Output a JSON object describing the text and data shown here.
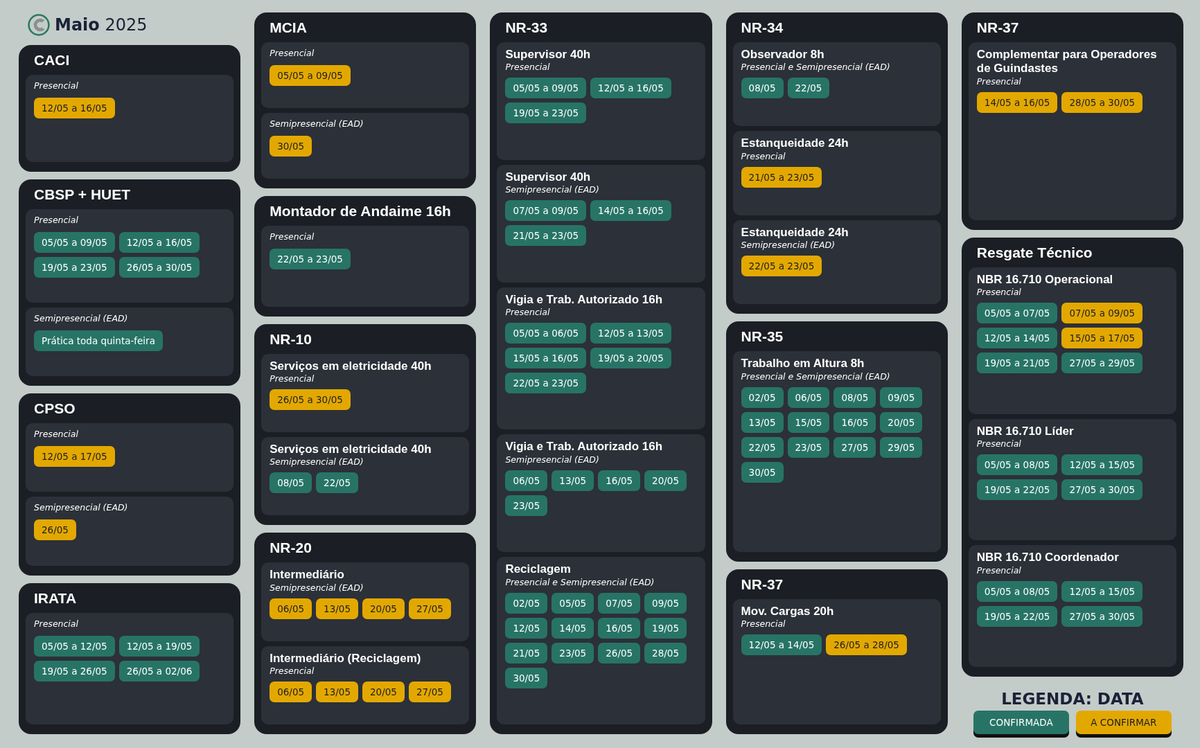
{
  "header": {
    "title": "**Maio** 2025"
  },
  "columns": [
    [
      {
        "title": "CACI",
        "sections": [
          {
            "mode": "Presencial",
            "dates": [
              {
                "text": "12/05 a 16/05",
                "confirmed": false
              }
            ]
          }
        ]
      },
      {
        "title": "CBSP + HUET",
        "sections": [
          {
            "mode": "Presencial",
            "dates": [
              {
                "text": "05/05 a 09/05",
                "confirmed": true
              },
              {
                "text": "12/05 a 16/05",
                "confirmed": true
              },
              {
                "text": "19/05 a 23/05",
                "confirmed": true
              },
              {
                "text": "26/05 a 30/05",
                "confirmed": true
              }
            ]
          },
          {
            "mode": "Semipresencial (EAD)",
            "dates": [
              {
                "text": "Prática toda quinta-feira",
                "confirmed": true
              }
            ]
          }
        ]
      },
      {
        "title": "CPSO",
        "sections": [
          {
            "mode": "Presencial",
            "dates": [
              {
                "text": "12/05 a 17/05",
                "confirmed": false
              }
            ]
          },
          {
            "mode": "Semipresencial (EAD)",
            "dates": [
              {
                "text": "26/05",
                "confirmed": false
              }
            ]
          }
        ]
      },
      {
        "title": "IRATA",
        "sections": [
          {
            "mode": "Presencial",
            "dates": [
              {
                "text": "05/05 a 12/05",
                "confirmed": true
              },
              {
                "text": "12/05 a 19/05",
                "confirmed": true
              },
              {
                "text": "19/05 a 26/05",
                "confirmed": true
              },
              {
                "text": "26/05 a 02/06",
                "confirmed": true
              }
            ]
          }
        ]
      }
    ],
    [
      {
        "title": "MCIA",
        "sections": [
          {
            "mode": "Presencial",
            "dates": [
              {
                "text": "05/05 a 09/05",
                "confirmed": false
              }
            ]
          },
          {
            "mode": "Semipresencial (EAD)",
            "dates": [
              {
                "text": "30/05",
                "confirmed": false
              }
            ]
          }
        ]
      },
      {
        "title": "Montador de Andaime 16h",
        "sections": [
          {
            "mode": "Presencial",
            "dates": [
              {
                "text": "22/05 a 23/05",
                "confirmed": true
              }
            ]
          }
        ]
      },
      {
        "title": "NR-10",
        "sections": [
          {
            "name": "Serviços em eletricidade 40h",
            "mode": "Presencial",
            "dates": [
              {
                "text": "26/05 a 30/05",
                "confirmed": false
              }
            ]
          },
          {
            "name": "Serviços em eletricidade 40h",
            "mode": "Semipresencial (EAD)",
            "dates": [
              {
                "text": "08/05",
                "confirmed": true
              },
              {
                "text": "22/05",
                "confirmed": true
              }
            ]
          }
        ]
      },
      {
        "title": "NR-20",
        "sections": [
          {
            "name": "Intermediário",
            "mode": "Semipresencial (EAD)",
            "dates": [
              {
                "text": "06/05",
                "confirmed": false
              },
              {
                "text": "13/05",
                "confirmed": false
              },
              {
                "text": "20/05",
                "confirmed": false
              },
              {
                "text": "27/05",
                "confirmed": false
              }
            ]
          },
          {
            "name": "Intermediário (Reciclagem)",
            "mode": "Presencial",
            "dates": [
              {
                "text": "06/05",
                "confirmed": false
              },
              {
                "text": "13/05",
                "confirmed": false
              },
              {
                "text": "20/05",
                "confirmed": false
              },
              {
                "text": "27/05",
                "confirmed": false
              }
            ]
          }
        ]
      }
    ],
    [
      {
        "title": "NR-33",
        "sections": [
          {
            "name": "Supervisor 40h",
            "mode": "Presencial",
            "dates": [
              {
                "text": "05/05 a 09/05",
                "confirmed": true
              },
              {
                "text": "12/05 a 16/05",
                "confirmed": true
              },
              {
                "text": "19/05 a 23/05",
                "confirmed": true
              }
            ]
          },
          {
            "name": "Supervisor 40h",
            "mode": "Semipresencial (EAD)",
            "dates": [
              {
                "text": "07/05 a 09/05",
                "confirmed": true
              },
              {
                "text": "14/05 a 16/05",
                "confirmed": true
              },
              {
                "text": "21/05 a 23/05",
                "confirmed": true
              }
            ]
          },
          {
            "name": "Vigia e Trab. Autorizado 16h",
            "mode": "Presencial",
            "dates": [
              {
                "text": "05/05 a 06/05",
                "confirmed": true
              },
              {
                "text": "12/05 a 13/05",
                "confirmed": true
              },
              {
                "text": "15/05 a 16/05",
                "confirmed": true
              },
              {
                "text": "19/05 a 20/05",
                "confirmed": true
              },
              {
                "text": "22/05 a 23/05",
                "confirmed": true
              }
            ]
          },
          {
            "name": "Vigia e Trab. Autorizado 16h",
            "mode": "Semipresencial (EAD)",
            "dates": [
              {
                "text": "06/05",
                "confirmed": true
              },
              {
                "text": "13/05",
                "confirmed": true
              },
              {
                "text": "16/05",
                "confirmed": true
              },
              {
                "text": "20/05",
                "confirmed": true
              },
              {
                "text": "23/05",
                "confirmed": true
              }
            ]
          },
          {
            "name": "Reciclagem",
            "mode": "Presencial e Semipresencial (EAD)",
            "dates": [
              {
                "text": "02/05",
                "confirmed": true
              },
              {
                "text": "05/05",
                "confirmed": true
              },
              {
                "text": "07/05",
                "confirmed": true
              },
              {
                "text": "09/05",
                "confirmed": true
              },
              {
                "text": "12/05",
                "confirmed": true
              },
              {
                "text": "14/05",
                "confirmed": true
              },
              {
                "text": "16/05",
                "confirmed": true
              },
              {
                "text": "19/05",
                "confirmed": true
              },
              {
                "text": "21/05",
                "confirmed": true
              },
              {
                "text": "23/05",
                "confirmed": true
              },
              {
                "text": "26/05",
                "confirmed": true
              },
              {
                "text": "28/05",
                "confirmed": true
              },
              {
                "text": "30/05",
                "confirmed": true
              }
            ]
          }
        ]
      }
    ],
    [
      {
        "title": "NR-34",
        "sections": [
          {
            "name": "Observador 8h",
            "mode": "Presencial e Semipresencial (EAD)",
            "dates": [
              {
                "text": "08/05",
                "confirmed": true
              },
              {
                "text": "22/05",
                "confirmed": true
              }
            ]
          },
          {
            "name": "Estanqueidade 24h",
            "mode": "Presencial",
            "dates": [
              {
                "text": "21/05 a 23/05",
                "confirmed": false
              }
            ]
          },
          {
            "name": "Estanqueidade 24h",
            "mode": "Semipresencial (EAD)",
            "dates": [
              {
                "text": "22/05 a 23/05",
                "confirmed": false
              }
            ]
          }
        ]
      },
      {
        "title": "NR-35",
        "sections": [
          {
            "name": "Trabalho em Altura 8h",
            "mode": "Presencial e Semipresencial (EAD)",
            "dates": [
              {
                "text": "02/05",
                "confirmed": true
              },
              {
                "text": "06/05",
                "confirmed": true
              },
              {
                "text": "08/05",
                "confirmed": true
              },
              {
                "text": "09/05",
                "confirmed": true
              },
              {
                "text": "13/05",
                "confirmed": true
              },
              {
                "text": "15/05",
                "confirmed": true
              },
              {
                "text": "16/05",
                "confirmed": true
              },
              {
                "text": "20/05",
                "confirmed": true
              },
              {
                "text": "22/05",
                "confirmed": true
              },
              {
                "text": "23/05",
                "confirmed": true
              },
              {
                "text": "27/05",
                "confirmed": true
              },
              {
                "text": "29/05",
                "confirmed": true
              },
              {
                "text": "30/05",
                "confirmed": true
              }
            ]
          }
        ]
      },
      {
        "title": "NR-37",
        "sections": [
          {
            "name": "Mov. Cargas  20h",
            "mode": "Presencial",
            "dates": [
              {
                "text": "12/05 a 14/05",
                "confirmed": true
              },
              {
                "text": "26/05 a 28/05",
                "confirmed": false
              }
            ]
          }
        ]
      }
    ],
    [
      {
        "title": "NR-37",
        "sections": [
          {
            "name": "Complementar para Operadores de Guindastes",
            "mode": "Presencial",
            "dates": [
              {
                "text": "14/05 a 16/05",
                "confirmed": false
              },
              {
                "text": "28/05 a 30/05",
                "confirmed": false
              }
            ]
          }
        ]
      },
      {
        "title": "Resgate Técnico",
        "sections": [
          {
            "name": "NBR 16.710 Operacional",
            "mode": "Presencial",
            "dates": [
              {
                "text": "05/05 a 07/05",
                "confirmed": true
              },
              {
                "text": "07/05 a 09/05",
                "confirmed": false
              },
              {
                "text": "12/05 a 14/05",
                "confirmed": true
              },
              {
                "text": "15/05 a 17/05",
                "confirmed": false
              },
              {
                "text": "19/05 a 21/05",
                "confirmed": true
              },
              {
                "text": "27/05 a 29/05",
                "confirmed": true
              }
            ]
          },
          {
            "name": "NBR 16.710 Líder",
            "mode": "Presencial",
            "dates": [
              {
                "text": "05/05 a 08/05",
                "confirmed": true
              },
              {
                "text": "12/05 a 15/05",
                "confirmed": true
              },
              {
                "text": "19/05 a 22/05",
                "confirmed": true
              },
              {
                "text": "27/05 a 30/05",
                "confirmed": true
              }
            ]
          },
          {
            "name": "NBR 16.710 Coordenador",
            "mode": "Presencial",
            "dates": [
              {
                "text": "05/05 a 08/05",
                "confirmed": true
              },
              {
                "text": "12/05 a 15/05",
                "confirmed": true
              },
              {
                "text": "19/05 a 22/05",
                "confirmed": true
              },
              {
                "text": "27/05 a 30/05",
                "confirmed": true
              }
            ]
          }
        ]
      }
    ]
  ],
  "legend": {
    "title": "LEGENDA: DATA",
    "items": [
      {
        "label": "CONFIRMADA",
        "confirmed": true
      },
      {
        "label": "A CONFIRMAR",
        "confirmed": false
      }
    ]
  }
}
